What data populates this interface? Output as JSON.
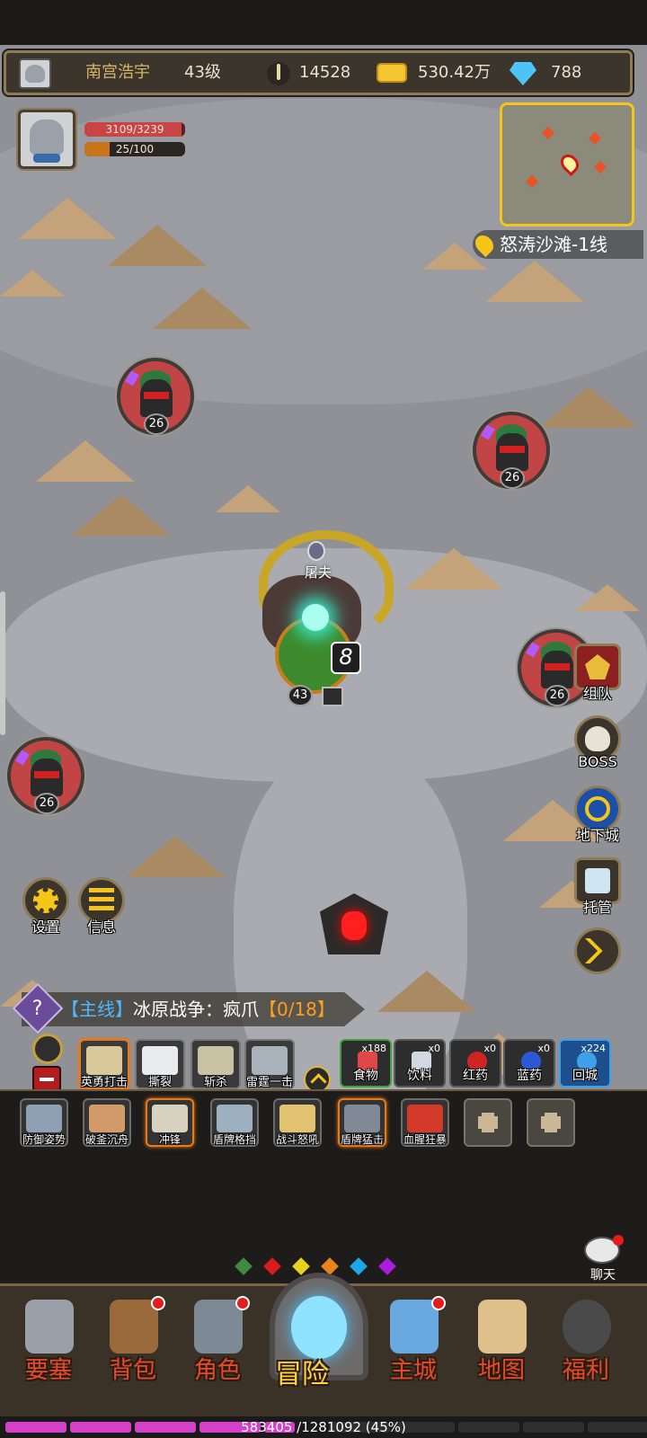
{
  "player": {
    "name": "南宫浩宇",
    "level": "43级",
    "combat_power": "14528",
    "gold": "530.42万",
    "diamonds": "788"
  },
  "status": {
    "hp": "3109/3239",
    "hp_fraction": 0.96,
    "mp": "25/100",
    "mp_fraction": 0.25
  },
  "location": "怒涛沙滩-1线",
  "enemies": [
    {
      "level": "26"
    },
    {
      "level": "26"
    },
    {
      "level": "26"
    },
    {
      "level": "26"
    }
  ],
  "boss": {
    "name": "屠夫",
    "level": "43",
    "combo": "8"
  },
  "side_buttons": {
    "team": "组队",
    "boss": "BOSS",
    "dungeon": "地下城",
    "auto": "托管"
  },
  "left_buttons": {
    "settings": "设置",
    "info": "信息"
  },
  "quest": {
    "tag": "【主线】",
    "title": "冰原战争：疯爪",
    "progress": "【0/18】"
  },
  "skill_bar": [
    "英勇打击",
    "撕裂",
    "斩杀",
    "雷霆一击"
  ],
  "items": [
    {
      "label": "食物",
      "count": "x188",
      "color": "#e04848"
    },
    {
      "label": "饮料",
      "count": "x0",
      "color": "#cfd8e3"
    },
    {
      "label": "红药",
      "count": "x0",
      "color": "#d02424"
    },
    {
      "label": "蓝药",
      "count": "x0",
      "color": "#2b59d6"
    },
    {
      "label": "回城",
      "count": "x224",
      "color": "#3fa0e8"
    }
  ],
  "passive_skills": [
    "防御姿势",
    "破釜沉舟",
    "冲锋",
    "盾牌格挡",
    "战斗怒吼",
    "盾牌猛击",
    "血腥狂暴"
  ],
  "chat_label": "聊天",
  "nav": [
    {
      "label": "要塞",
      "icon": "fortress-icon",
      "badge": false
    },
    {
      "label": "背包",
      "icon": "backpack-icon",
      "badge": true
    },
    {
      "label": "角色",
      "icon": "helmet-icon",
      "badge": true
    },
    {
      "label": "冒险",
      "icon": "portal-icon",
      "badge": false
    },
    {
      "label": "主城",
      "icon": "castle-icon",
      "badge": true
    },
    {
      "label": "地图",
      "icon": "scroll-map-icon",
      "badge": false
    },
    {
      "label": "福利",
      "icon": "gift-icon",
      "badge": false
    }
  ],
  "experience": {
    "text": "583405 /1281092 (45%)",
    "fraction": 0.45
  },
  "colors": {
    "accent_gold": "#f5c518",
    "nav_label": "#e64a2a",
    "quest_progress": "#ff9e1b",
    "quest_tag": "#4db8ff"
  }
}
